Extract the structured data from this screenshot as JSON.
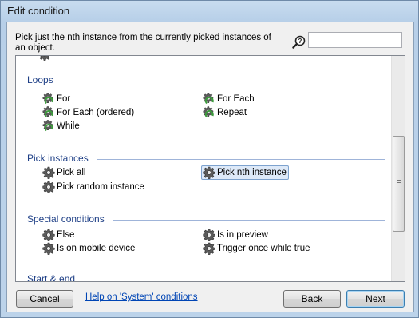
{
  "window": {
    "title": "Edit condition"
  },
  "description": "Pick just the nth instance from the currently picked instances of an object.",
  "search": {
    "value": "",
    "placeholder": ""
  },
  "sections": {
    "loops": {
      "label": "Loops",
      "items": [
        "For",
        "For Each",
        "For Each (ordered)",
        "Repeat",
        "While"
      ],
      "icon": "loop-icon"
    },
    "pick_instances": {
      "label": "Pick instances",
      "items": [
        "Pick all",
        "Pick nth instance",
        "Pick random instance"
      ],
      "icon": "gear-icon",
      "selected": "Pick nth instance"
    },
    "special_conditions": {
      "label": "Special conditions",
      "items": [
        "Else",
        "Is in preview",
        "Is on mobile device",
        "Trigger once while true"
      ],
      "icon": "gear-icon"
    },
    "start_end": {
      "label": "Start & end"
    }
  },
  "footer": {
    "cancel_label": "Cancel",
    "help_label": "Help on 'System' conditions",
    "back_label": "Back",
    "next_label": "Next"
  },
  "colors": {
    "section_heading": "#1e3f86",
    "link": "#0045b5",
    "selection_bg": "#dde9f8",
    "loop_icon_green": "#3d9b3d"
  }
}
